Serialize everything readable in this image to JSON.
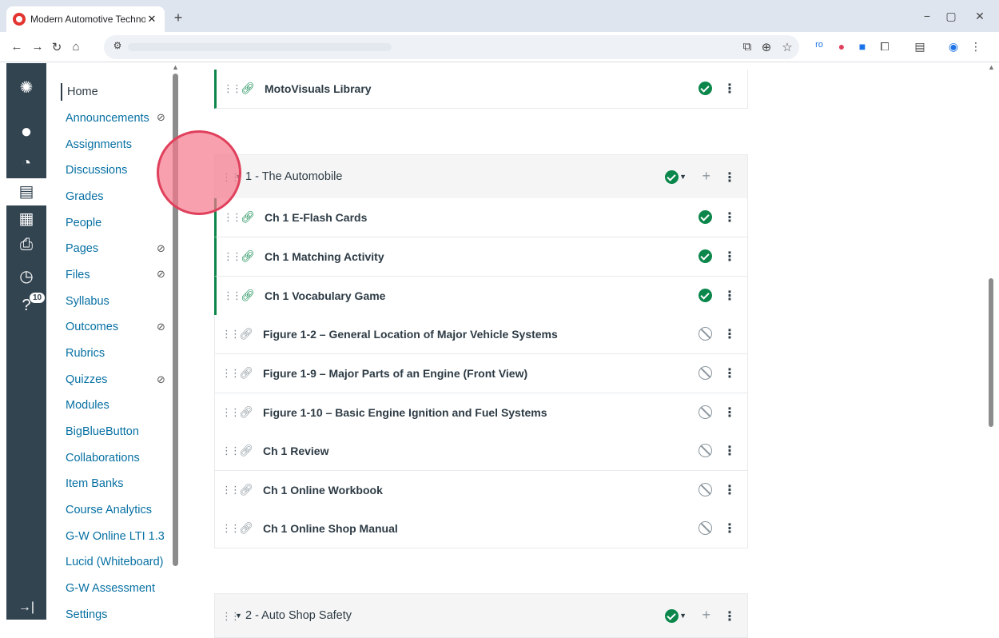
{
  "browser": {
    "tab_title": "Modern Automotive Technology",
    "tab_close": "✕",
    "new_tab": "+",
    "win_min": "−",
    "win_restore": "▢",
    "win_close": "✕"
  },
  "global_nav": {
    "calendar_badge": "10"
  },
  "course_nav": {
    "items": [
      {
        "label": "Home"
      },
      {
        "label": "Announcements"
      },
      {
        "label": "Assignments"
      },
      {
        "label": "Discussions"
      },
      {
        "label": "Grades"
      },
      {
        "label": "People"
      },
      {
        "label": "Pages"
      },
      {
        "label": "Files"
      },
      {
        "label": "Syllabus"
      },
      {
        "label": "Outcomes"
      },
      {
        "label": "Rubrics"
      },
      {
        "label": "Quizzes"
      },
      {
        "label": "Modules"
      },
      {
        "label": "BigBlueButton"
      },
      {
        "label": "Collaborations"
      },
      {
        "label": "Item Banks"
      },
      {
        "label": "Course Analytics"
      },
      {
        "label": "G-W Online LTI 1.3"
      },
      {
        "label": "Lucid (Whiteboard)"
      },
      {
        "label": "G-W Assessment"
      },
      {
        "label": "Settings"
      }
    ]
  },
  "modules": {
    "top_item": {
      "label": "MotoVisuals Library",
      "status": "published"
    },
    "module1": {
      "title": "1 - The Automobile",
      "items": [
        {
          "label": "Ch 1 E-Flash Cards",
          "status": "published"
        },
        {
          "label": "Ch 1 Matching Activity",
          "status": "published"
        },
        {
          "label": "Ch 1 Vocabulary Game",
          "status": "published"
        },
        {
          "label": "Figure 1-2 – General Location of Major Vehicle Systems",
          "status": "unpublished"
        },
        {
          "label": "Figure 1-9 – Major Parts of an Engine (Front View)",
          "status": "unpublished"
        },
        {
          "label": "Figure 1-10 – Basic Engine Ignition and Fuel Systems",
          "status": "unpublished"
        },
        {
          "label": "Ch 1 Review",
          "status": "unpublished"
        },
        {
          "label": "Ch 1 Online Workbook",
          "status": "unpublished"
        },
        {
          "label": "Ch 1 Online Shop Manual",
          "status": "unpublished"
        }
      ]
    },
    "module2": {
      "title": "2 - Auto Shop Safety"
    }
  },
  "colors": {
    "published": "#0b874b",
    "nav_bg": "#334451",
    "link": "#0770a3"
  }
}
